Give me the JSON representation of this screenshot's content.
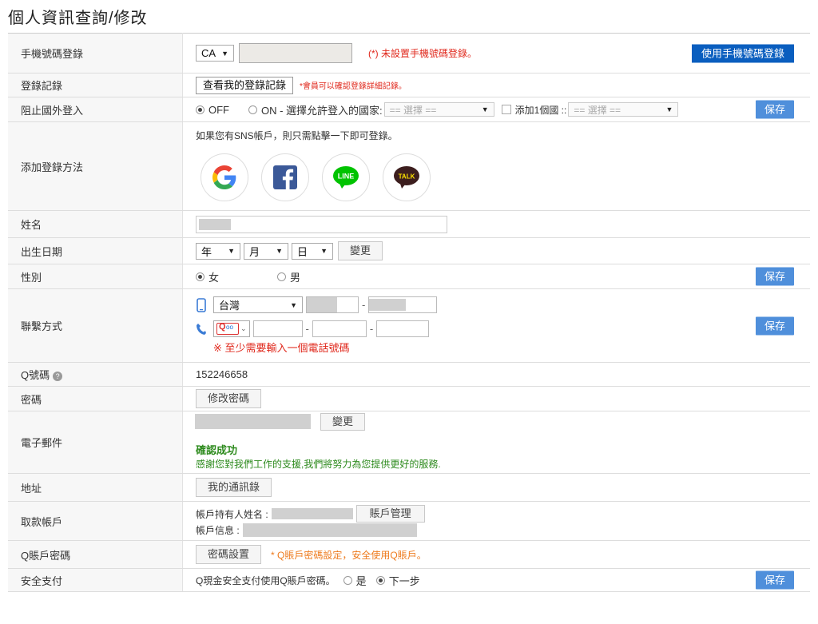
{
  "page": {
    "title": "個人資訊查詢/修改"
  },
  "rows": {
    "mobile_login": {
      "label": "手機號碼登錄",
      "country": "CA",
      "warning": "(*) 未設置手機號碼登錄。",
      "button": "使用手機號碼登錄"
    },
    "login_record": {
      "label": "登錄記錄",
      "button": "查看我的登錄記錄",
      "note": "*會員可以確認登錄詳細記錄。"
    },
    "block_foreign": {
      "label": "阻止國外登入",
      "off_label": "OFF",
      "on_label": "ON - 選擇允許登入的國家:",
      "select_placeholder": "== 選擇 ==",
      "add_label": "添加1個國 ::",
      "select2_placeholder": "== 選擇 ==",
      "save": "保存"
    },
    "sns": {
      "label": "添加登錄方法",
      "intro": "如果您有SNS帳戶，則只需點擊一下即可登錄。",
      "icons": [
        "google-icon",
        "facebook-icon",
        "line-icon",
        "kakaotalk-icon"
      ],
      "line_text": "LINE",
      "talk_text": "TALK"
    },
    "name": {
      "label": "姓名"
    },
    "birth": {
      "label": "出生日期",
      "year": "年",
      "month": "月",
      "day": "日",
      "button": "變更"
    },
    "gender": {
      "label": "性別",
      "female": "女",
      "male": "男",
      "selected": "女",
      "save": "保存"
    },
    "contact": {
      "label": "聯繫方式",
      "country": "台灣",
      "hint": "※ 至少需要輸入一個電話號碼",
      "save": "保存"
    },
    "qnumber": {
      "label": "Q號碼",
      "value": "152246658"
    },
    "password": {
      "label": "密碼",
      "button": "修改密碼"
    },
    "email": {
      "label": "電子郵件",
      "button": "變更",
      "confirmed": "確認成功",
      "thanks": "感謝您對我們工作的支援,我們將努力為您提供更好的服務."
    },
    "address": {
      "label": "地址",
      "button": "我的通訊錄"
    },
    "payout": {
      "label": "取款帳戶",
      "holder_label": "帳戶持有人姓名 :",
      "button": "賬戶管理",
      "info_label": "帳戶信息 :"
    },
    "q_account_pw": {
      "label": "Q賬戶密碼",
      "button": "密碼設置",
      "note": "* Q賬戶密碼設定，安全使用Q賬戶。"
    },
    "safe_pay": {
      "label": "安全支付",
      "text": "Q現金安全支付使用Q賬戶密碼。",
      "yes": "是",
      "next": "下一步",
      "save": "保存"
    }
  },
  "colors": {
    "save_blue": "#4f8fdb",
    "primary_blue": "#0a5ebf",
    "warning_red": "#e0281c",
    "note_orange": "#ee7b1e",
    "success_green": "#2e8b1e"
  }
}
